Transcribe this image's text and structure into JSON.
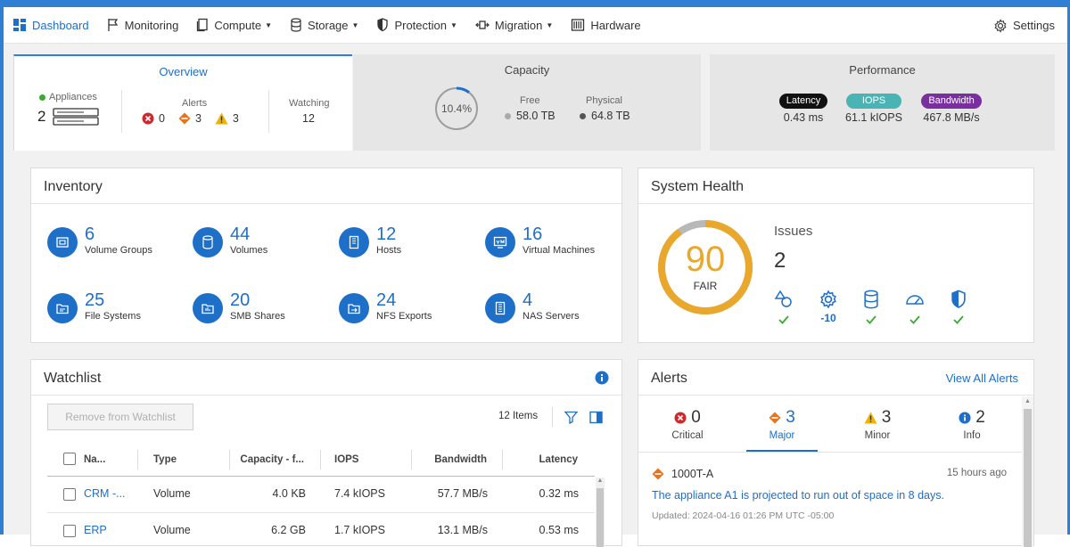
{
  "nav": {
    "items": [
      {
        "label": "Dashboard",
        "icon": "dashboard-grid-icon",
        "dropdown": false
      },
      {
        "label": "Monitoring",
        "icon": "flag-icon",
        "dropdown": false
      },
      {
        "label": "Compute",
        "icon": "compute-icon",
        "dropdown": true
      },
      {
        "label": "Storage",
        "icon": "database-icon",
        "dropdown": true
      },
      {
        "label": "Protection",
        "icon": "shield-icon",
        "dropdown": true
      },
      {
        "label": "Migration",
        "icon": "migration-icon",
        "dropdown": true
      },
      {
        "label": "Hardware",
        "icon": "hardware-icon",
        "dropdown": false
      }
    ],
    "settings_label": "Settings"
  },
  "overview": {
    "tab_label": "Overview",
    "appliances_label": "Appliances",
    "appliances_count": "2",
    "alerts_label": "Alerts",
    "alerts_critical": "0",
    "alerts_major": "3",
    "alerts_minor": "3",
    "watching_label": "Watching",
    "watching_count": "12"
  },
  "capacity": {
    "tab_label": "Capacity",
    "percent_label": "10.4%",
    "used_fraction": 0.104,
    "free_label": "Free",
    "free_value": "58.0 TB",
    "physical_label": "Physical",
    "physical_value": "64.8 TB"
  },
  "performance": {
    "tab_label": "Performance",
    "latency_label": "Latency",
    "latency_value": "0.43 ms",
    "iops_label": "IOPS",
    "iops_value": "61.1 kIOPS",
    "bandwidth_label": "Bandwidth",
    "bandwidth_value": "467.8 MB/s"
  },
  "inventory": {
    "title": "Inventory",
    "items": [
      {
        "value": "6",
        "label": "Volume Groups"
      },
      {
        "value": "44",
        "label": "Volumes"
      },
      {
        "value": "12",
        "label": "Hosts"
      },
      {
        "value": "16",
        "label": "Virtual Machines"
      },
      {
        "value": "25",
        "label": "File Systems"
      },
      {
        "value": "20",
        "label": "SMB Shares"
      },
      {
        "value": "24",
        "label": "NFS Exports"
      },
      {
        "value": "4",
        "label": "NAS Servers"
      }
    ]
  },
  "health": {
    "title": "System Health",
    "score": "90",
    "score_fraction": 0.9,
    "rating": "FAIR",
    "issues_label": "Issues",
    "issues_count": "2",
    "categories": [
      {
        "icon": "shapes-icon",
        "status": "ok",
        "value": ""
      },
      {
        "icon": "gear-icon",
        "status": "issue",
        "value": "-10"
      },
      {
        "icon": "database-icon",
        "status": "ok",
        "value": ""
      },
      {
        "icon": "gauge-icon",
        "status": "ok",
        "value": ""
      },
      {
        "icon": "shield-icon",
        "status": "ok",
        "value": ""
      }
    ]
  },
  "watchlist": {
    "title": "Watchlist",
    "remove_button": "Remove from Watchlist",
    "items_count": "12 Items",
    "columns": [
      "Na...",
      "Type",
      "Capacity - f...",
      "IOPS",
      "Bandwidth",
      "Latency"
    ],
    "rows": [
      {
        "name": "CRM -...",
        "type": "Volume",
        "capacity": "4.0 KB",
        "iops": "7.4 kIOPS",
        "bandwidth": "57.7 MB/s",
        "latency": "0.32 ms"
      },
      {
        "name": "ERP",
        "type": "Volume",
        "capacity": "6.2 GB",
        "iops": "1.7 kIOPS",
        "bandwidth": "13.1 MB/s",
        "latency": "0.53 ms"
      }
    ]
  },
  "alerts": {
    "title": "Alerts",
    "view_all": "View All Alerts",
    "summary": [
      {
        "count": "0",
        "label": "Critical",
        "severity": "critical"
      },
      {
        "count": "3",
        "label": "Major",
        "severity": "major"
      },
      {
        "count": "3",
        "label": "Minor",
        "severity": "minor"
      },
      {
        "count": "2",
        "label": "Info",
        "severity": "info"
      }
    ],
    "entries": [
      {
        "source": "1000T-A",
        "time": "15 hours ago",
        "message": "The appliance A1 is projected to run out of space in 8 days.",
        "updated": "Updated: 2024-04-16 01:26 PM UTC -05:00"
      }
    ]
  },
  "colors": {
    "accent": "#1e6fc8",
    "critical": "#d0272c",
    "major": "#e8731a",
    "minor": "#f2b200",
    "info": "#1e6fc8",
    "health_ring": "#e9a82b",
    "ok_check": "#3aa935",
    "latency_pill": "#111111",
    "iops_pill": "#4ab3b3",
    "bandwidth_pill": "#7a2fa0"
  }
}
